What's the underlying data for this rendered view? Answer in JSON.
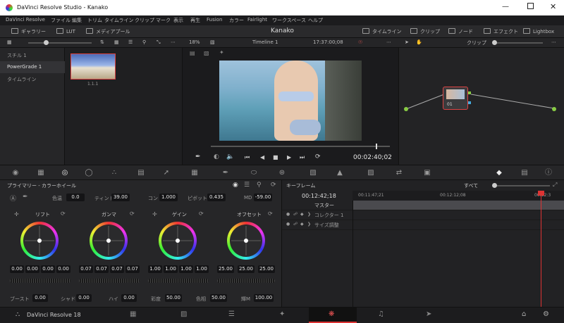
{
  "window": {
    "title": "DaVinci Resolve Studio - Kanako"
  },
  "menu": [
    "DaVinci Resolve",
    "ファイル",
    "編集",
    "トリム",
    "タイムライン",
    "クリップ",
    "マーク",
    "表示",
    "再生",
    "Fusion",
    "カラー",
    "Fairlight",
    "ワークスペース",
    "ヘルプ"
  ],
  "toolbar": {
    "gallery": "ギャラリー",
    "lut": "LUT",
    "mediapool": "メディアプール",
    "project": "Kanako",
    "timeline": "タイムライン",
    "clips": "クリップ",
    "nodes": "ノード",
    "effects": "エフェクト",
    "lightbox": "Lightbox"
  },
  "subbar": {
    "zoom": "18%",
    "timeline_name": "Timeline 1",
    "timecode": "17:37:00;08",
    "node_mode": "クリップ"
  },
  "left_panel": {
    "items": [
      "スチル 1",
      "PowerGrade 1",
      "タイムライン"
    ]
  },
  "gallery": {
    "still_label": "1.1.1"
  },
  "viewer": {
    "timecode": "00:02:40;02"
  },
  "node": {
    "label": "01"
  },
  "wheels": {
    "title": "プライマリー - カラーホイール",
    "top": {
      "color_temp_label": "色温",
      "color_temp": "0.0",
      "tint_label": "ティント",
      "tint": "39.00",
      "contrast_label": "コン",
      "contrast": "1.000",
      "pivot_label": "ピボット",
      "pivot": "0.435",
      "md_label": "MD",
      "md": "-59.00"
    },
    "lift": {
      "name": "リフト",
      "values": [
        "0.00",
        "0.00",
        "0.00",
        "0.00"
      ]
    },
    "gamma": {
      "name": "ガンマ",
      "values": [
        "0.07",
        "0.07",
        "0.07",
        "0.07"
      ]
    },
    "gain": {
      "name": "ゲイン",
      "values": [
        "1.00",
        "1.00",
        "1.00",
        "1.00"
      ]
    },
    "offset": {
      "name": "オフセット",
      "values": [
        "25.00",
        "25.00",
        "25.00"
      ]
    },
    "bottom": {
      "boost_label": "ブースト",
      "boost": "0.00",
      "shadow_label": "シャド",
      "shadow": "0.00",
      "high_label": "ハイ",
      "high": "0.00",
      "sat_label": "彩度",
      "sat": "50.00",
      "hue_label": "色相",
      "hue": "50.00",
      "lummix_label": "輝M",
      "lummix": "100.00"
    }
  },
  "keyframes": {
    "title": "キーフレーム",
    "filter": "すべて",
    "current_tc": "00:12:42;18",
    "ruler": [
      "00:11:47;21",
      "00:12:12;08",
      "00:12:3"
    ],
    "tracks": [
      "マスター",
      "コレクター 1",
      "サイズ調整"
    ]
  },
  "bottombar": {
    "app": "DaVinci Resolve 18"
  }
}
